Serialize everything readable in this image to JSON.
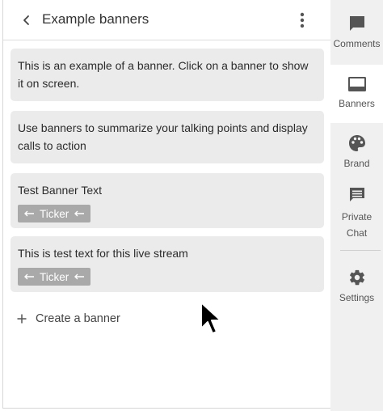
{
  "header": {
    "title": "Example banners",
    "back_icon": "chevron-left-icon",
    "menu_icon": "more-vertical-icon"
  },
  "banners": [
    {
      "text": "This is an example of a banner. Click on a banner to show it on screen.",
      "ticker": null
    },
    {
      "text": "Use banners to summarize your talking points and display calls to action",
      "ticker": null
    },
    {
      "text": "Test Banner Text",
      "ticker": "Ticker"
    },
    {
      "text": "This is test text for this live stream",
      "ticker": "Ticker"
    }
  ],
  "create_banner": {
    "label": "Create a banner",
    "icon": "plus-icon"
  },
  "sidebar": {
    "items": [
      {
        "label": "Comments",
        "icon": "comment-icon",
        "active": false
      },
      {
        "label": "Banners",
        "icon": "banner-icon",
        "active": true
      },
      {
        "label": "Brand",
        "icon": "palette-icon",
        "active": false
      },
      {
        "label_line1": "Private",
        "label_line2": "Chat",
        "icon": "chat-icon",
        "active": false
      },
      {
        "label": "Settings",
        "icon": "gear-icon",
        "active": false
      }
    ]
  },
  "colors": {
    "banner_bg": "#ebebeb",
    "ticker_bg": "#a9a9a9",
    "sidebar_bg": "#f0f0f0",
    "icon": "#555555"
  }
}
